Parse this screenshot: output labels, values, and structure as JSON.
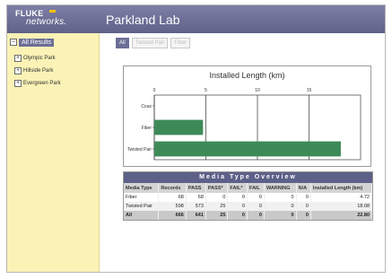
{
  "header": {
    "logo_top": "FLUKE",
    "logo_bottom": "networks.",
    "title": "Parkland Lab"
  },
  "sidebar": {
    "root_label": "All Results",
    "items": [
      {
        "label": "Olympic Park"
      },
      {
        "label": "Hillside Park"
      },
      {
        "label": "Evergreen Park"
      }
    ]
  },
  "tabs": [
    {
      "label": "All",
      "active": true
    },
    {
      "label": "Twisted Pair",
      "active": false
    },
    {
      "label": "Fiber",
      "active": false
    }
  ],
  "chart_data": {
    "type": "bar",
    "orientation": "horizontal",
    "title": "Installed Length (km)",
    "categories": [
      "Coax",
      "Fiber",
      "Twisted Pair"
    ],
    "values": [
      0,
      4.72,
      18.08
    ],
    "xlim": [
      0,
      20
    ],
    "xticks": [
      0,
      5,
      10,
      15
    ],
    "grid": true,
    "bar_color": "#3d8a58"
  },
  "table": {
    "title": "Media Type Overview",
    "columns": [
      "Media Type",
      "Records",
      "PASS",
      "PASS*",
      "FAIL*",
      "FAIL",
      "WARNING",
      "N/A",
      "Installed Length (km)"
    ],
    "rows": [
      [
        "Fiber",
        "68",
        "68",
        "0",
        "0",
        "0",
        "0",
        "0",
        "4.72"
      ],
      [
        "Twisted Pair",
        "598",
        "573",
        "25",
        "0",
        "0",
        "0",
        "0",
        "18.08"
      ]
    ],
    "total": [
      "All",
      "666",
      "641",
      "25",
      "0",
      "0",
      "0",
      "0",
      "22.80"
    ]
  }
}
